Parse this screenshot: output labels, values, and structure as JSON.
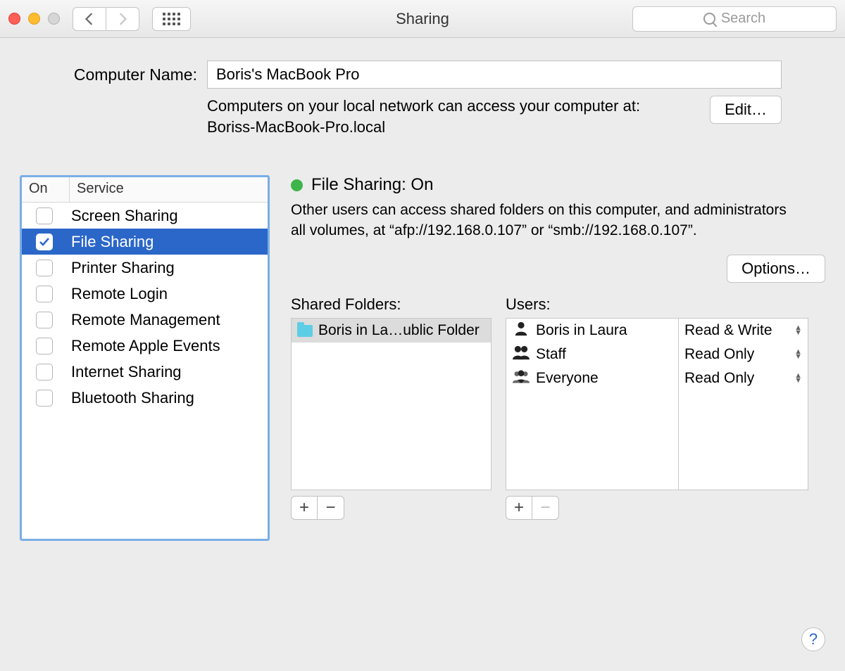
{
  "window": {
    "title": "Sharing"
  },
  "search": {
    "placeholder": "Search"
  },
  "header": {
    "name_label": "Computer Name:",
    "name_value": "Boris's MacBook Pro",
    "desc_line1": "Computers on your local network can access your computer at:",
    "desc_line2": "Boriss-MacBook-Pro.local",
    "edit_button": "Edit…"
  },
  "services": {
    "header_on": "On",
    "header_service": "Service",
    "items": [
      {
        "label": "Screen Sharing",
        "on": false,
        "selected": false
      },
      {
        "label": "File Sharing",
        "on": true,
        "selected": true
      },
      {
        "label": "Printer Sharing",
        "on": false,
        "selected": false
      },
      {
        "label": "Remote Login",
        "on": false,
        "selected": false
      },
      {
        "label": "Remote Management",
        "on": false,
        "selected": false
      },
      {
        "label": "Remote Apple Events",
        "on": false,
        "selected": false
      },
      {
        "label": "Internet Sharing",
        "on": false,
        "selected": false
      },
      {
        "label": "Bluetooth Sharing",
        "on": false,
        "selected": false
      }
    ]
  },
  "detail": {
    "status_title": "File Sharing: On",
    "status_desc": "Other users can access shared folders on this computer, and administrators all volumes, at “afp://192.168.0.107” or “smb://192.168.0.107”.",
    "options_button": "Options…",
    "folders_label": "Shared Folders:",
    "users_label": "Users:",
    "folders": [
      {
        "label": "Boris in La…ublic Folder",
        "selected": true
      }
    ],
    "users": [
      {
        "label": "Boris in Laura",
        "type": "single"
      },
      {
        "label": "Staff",
        "type": "pair"
      },
      {
        "label": "Everyone",
        "type": "group"
      }
    ],
    "perms": [
      {
        "label": "Read & Write"
      },
      {
        "label": "Read Only"
      },
      {
        "label": "Read Only"
      }
    ]
  },
  "help": "?"
}
